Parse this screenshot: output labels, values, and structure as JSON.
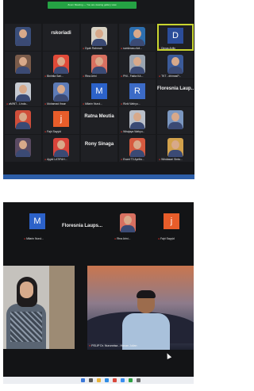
{
  "top_screenshot": {
    "banner": "Zoom Meeting — You are viewing gallery view",
    "tiles": [
      {
        "name": "",
        "big": "",
        "kind": "photo",
        "color": "#3a4e7a"
      },
      {
        "name": "",
        "big": "rskoriadi",
        "kind": "text",
        "color": "#1f2024"
      },
      {
        "name": "Dyah Rahmah",
        "big": "",
        "kind": "photo",
        "color": "#d8d2c4"
      },
      {
        "name": "sumimasu Adi...",
        "big": "",
        "kind": "photo",
        "color": "#2d6fb0"
      },
      {
        "name": "Dimas Arifin",
        "big": "D",
        "kind": "letter",
        "color": "#2b4d9a",
        "speaking": true
      },
      {
        "name": "",
        "big": "",
        "kind": "photo",
        "color": "#7a5b4a"
      },
      {
        "name": "Binintia Sari...",
        "big": "",
        "kind": "photo",
        "color": "#e04a38"
      },
      {
        "name": "Rina Arini",
        "big": "",
        "kind": "photo",
        "color": "#d87060"
      },
      {
        "name": "PNI - Fakta KA...",
        "big": "",
        "kind": "photo",
        "color": "#9aa4b0"
      },
      {
        "name": "TKT - dhimasP...",
        "big": "",
        "kind": "photo",
        "color": "#3b5b9a"
      },
      {
        "name": "aMINT - Linda...",
        "big": "",
        "kind": "photo",
        "color": "#c7cbd2"
      },
      {
        "name": "Muhamad Ihsan",
        "big": "",
        "kind": "photo",
        "color": "#5d7bb7"
      },
      {
        "name": "Milarin Nurul...",
        "big": "M",
        "kind": "letter",
        "color": "#2c62c9"
      },
      {
        "name": "Rizki Wahyu...",
        "big": "R",
        "kind": "letter",
        "color": "#3c6bc7"
      },
      {
        "name": "",
        "big": "Floresnia Laup...",
        "kind": "text",
        "color": "#1f2024"
      },
      {
        "name": "",
        "big": "",
        "kind": "photo",
        "color": "#d04e3a"
      },
      {
        "name": "Fajri Sayyid",
        "big": "j",
        "kind": "letter",
        "color": "#e85d2a"
      },
      {
        "name": "",
        "big": "Ratna Meutia",
        "kind": "text",
        "color": "#1f2024"
      },
      {
        "name": "Wirajaya Wahyu...",
        "big": "",
        "kind": "photo",
        "color": "#b9bfc9"
      },
      {
        "name": "",
        "big": "",
        "kind": "photo",
        "color": "#7b97c0"
      },
      {
        "name": "",
        "big": "",
        "kind": "photo",
        "color": "#5a4a62"
      },
      {
        "name": "Ayyid LATIFAH...",
        "big": "",
        "kind": "photo",
        "color": "#d9433a"
      },
      {
        "name": "",
        "big": "Rony Sinaga",
        "kind": "text",
        "color": "#1f2024"
      },
      {
        "name": "Evant T3 Aprilia...",
        "big": "",
        "kind": "photo",
        "color": "#d65a3f"
      },
      {
        "name": "Windasari Sinta...",
        "big": "",
        "kind": "photo",
        "color": "#d3a24c"
      }
    ]
  },
  "bottom_screenshot": {
    "strip": [
      {
        "name": "Milarin Nurul...",
        "letter": "M",
        "color": "#2c62c9"
      },
      {
        "name": "Rina Arini...",
        "letter": "",
        "color": "#d87060"
      },
      {
        "name": "Fajri Sayyid",
        "letter": "j",
        "color": "#e85d2a"
      }
    ],
    "strip_name": "Floresnia Laups...",
    "speaker_name": "PELIP Dr. Nurunnisa - Hanan Julian"
  },
  "colors": {
    "mic_muted": "#e2342b",
    "active_speaker": "#c9d530",
    "banner": "#25a244"
  }
}
